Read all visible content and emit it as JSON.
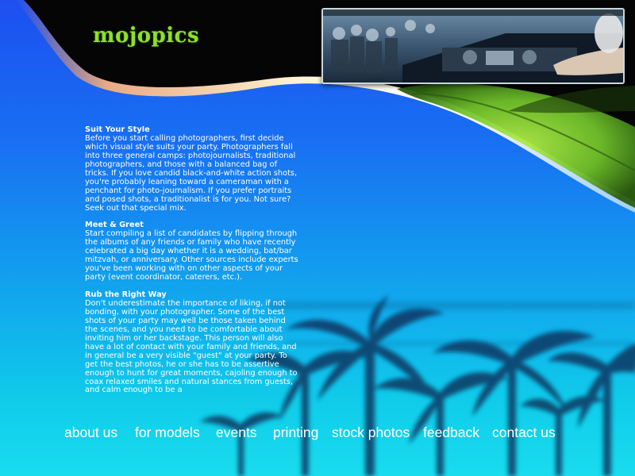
{
  "brand": {
    "logo_text": "mojopics"
  },
  "header": {
    "photo": "dj-mixing-console-photo"
  },
  "colors": {
    "sky_top": "#1d4ff0",
    "sky_bottom": "#19dcee",
    "logo_green": "#8ee02a",
    "leaf_green": "#7fcf2a"
  },
  "article": {
    "sections": [
      {
        "heading": "Suit Your Style",
        "body": "Before you start calling photographers, first decide which visual style suits your party. Photographers fall into three general camps: photojournalists, traditional photographers, and those with a balanced bag of tricks. If you love candid black-and-white action shots, you're probably leaning toward a cameraman with a penchant for photo-journalism. If you prefer portraits and posed shots, a traditionalist is for you. Not sure? Seek out that special mix."
      },
      {
        "heading": "Meet & Greet",
        "body": "Start compiling a list of candidates by flipping through the albums of any friends or family who have recently celebrated a big day whether it is a wedding, bat/bar mitzvah, or anniversary. Other sources include experts you've been working with on other aspects of your party (event coordinator, caterers, etc.)."
      },
      {
        "heading": "Rub the Right Way",
        "body": "Don't underestimate the importance of liking, if not bonding, with your photographer. Some of the best shots of your party may well be those taken behind the scenes, and you need to be comfortable about inviting him or her backstage. This person will also have a lot of contact with your family and friends, and in general be a very visible \"guest\" at your party. To get the best photos, he or she has to be assertive enough to hunt for great moments, cajoling enough to coax relaxed smiles and natural stances from guests, and calm enough to be a"
      }
    ]
  },
  "nav": {
    "items": [
      {
        "label": "about us"
      },
      {
        "label": "for models"
      },
      {
        "label": "events"
      },
      {
        "label": "printing"
      },
      {
        "label": "stock photos"
      },
      {
        "label": "feedback"
      },
      {
        "label": "contact us"
      }
    ]
  }
}
